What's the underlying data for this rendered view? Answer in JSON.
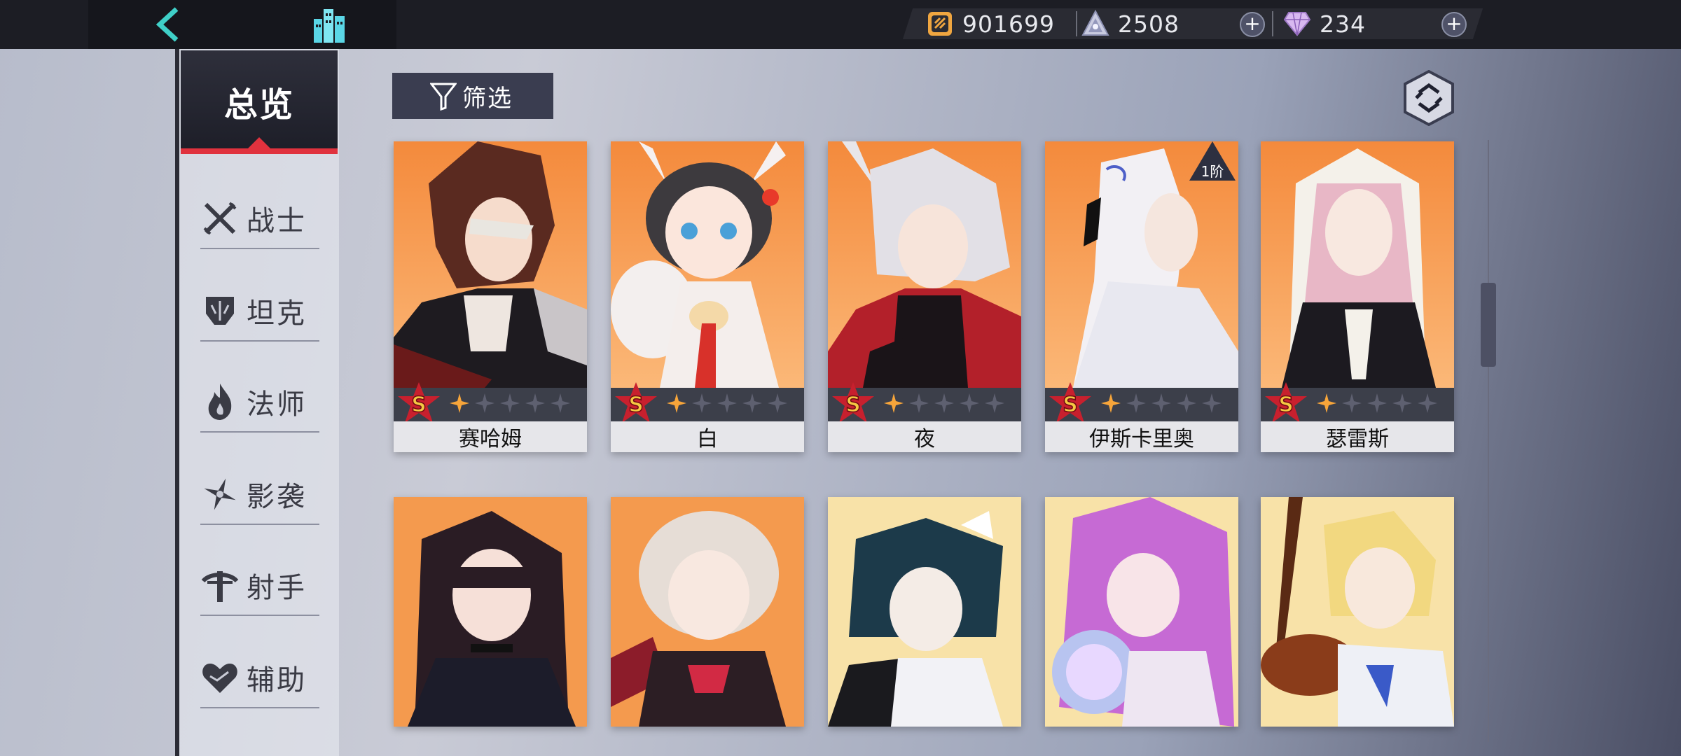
{
  "topbar": {
    "currencies": [
      {
        "name": "gold",
        "icon": "coin-icon",
        "value": "901699",
        "has_plus": false
      },
      {
        "name": "stamina",
        "icon": "stamina-icon",
        "value": "2508",
        "has_plus": true
      },
      {
        "name": "diamond",
        "icon": "diamond-icon",
        "value": "234",
        "has_plus": true
      }
    ],
    "plus_label": "+"
  },
  "sidebar": {
    "overview_label": "总览",
    "categories": [
      {
        "label": "战士",
        "icon": "swords-icon"
      },
      {
        "label": "坦克",
        "icon": "helmet-icon"
      },
      {
        "label": "法师",
        "icon": "flame-icon"
      },
      {
        "label": "影袭",
        "icon": "shuriken-icon"
      },
      {
        "label": "射手",
        "icon": "crossbow-icon"
      },
      {
        "label": "辅助",
        "icon": "heart-icon"
      }
    ]
  },
  "toolbar": {
    "filter_label": "筛选"
  },
  "characters": [
    {
      "name": "赛哈姆",
      "rank": "S",
      "stars_filled": 1,
      "stars_total": 6,
      "badge": ""
    },
    {
      "name": "白",
      "rank": "S",
      "stars_filled": 1,
      "stars_total": 6,
      "badge": ""
    },
    {
      "name": "夜",
      "rank": "S",
      "stars_filled": 1,
      "stars_total": 6,
      "badge": ""
    },
    {
      "name": "伊斯卡里奥",
      "rank": "S",
      "stars_filled": 1,
      "stars_total": 6,
      "badge": "1阶"
    },
    {
      "name": "瑟雷斯",
      "rank": "S",
      "stars_filled": 1,
      "stars_total": 6,
      "badge": ""
    }
  ],
  "colors": {
    "accent_red": "#e0323e",
    "card_orange": "#f7a058",
    "card_yellow": "#f8e2a8",
    "rank_gold": "#f5c842"
  }
}
